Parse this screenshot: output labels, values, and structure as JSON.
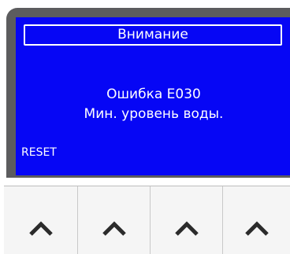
{
  "screen": {
    "title": "Внимание",
    "message_line1": "Ошибка E030",
    "message_line2": "Мин. уровень воды.",
    "reset_label": "RESET"
  },
  "keypad": {
    "keys": [
      {
        "icon": "chevron-up-icon"
      },
      {
        "icon": "chevron-up-icon"
      },
      {
        "icon": "chevron-up-icon"
      },
      {
        "icon": "chevron-up-icon"
      }
    ]
  },
  "colors": {
    "screen_background": "#0606f5",
    "screen_text": "#ffffff",
    "bezel": "#5c5c5e",
    "key_icon": "#2b2b2b",
    "keypad_background": "#f5f5f5"
  }
}
